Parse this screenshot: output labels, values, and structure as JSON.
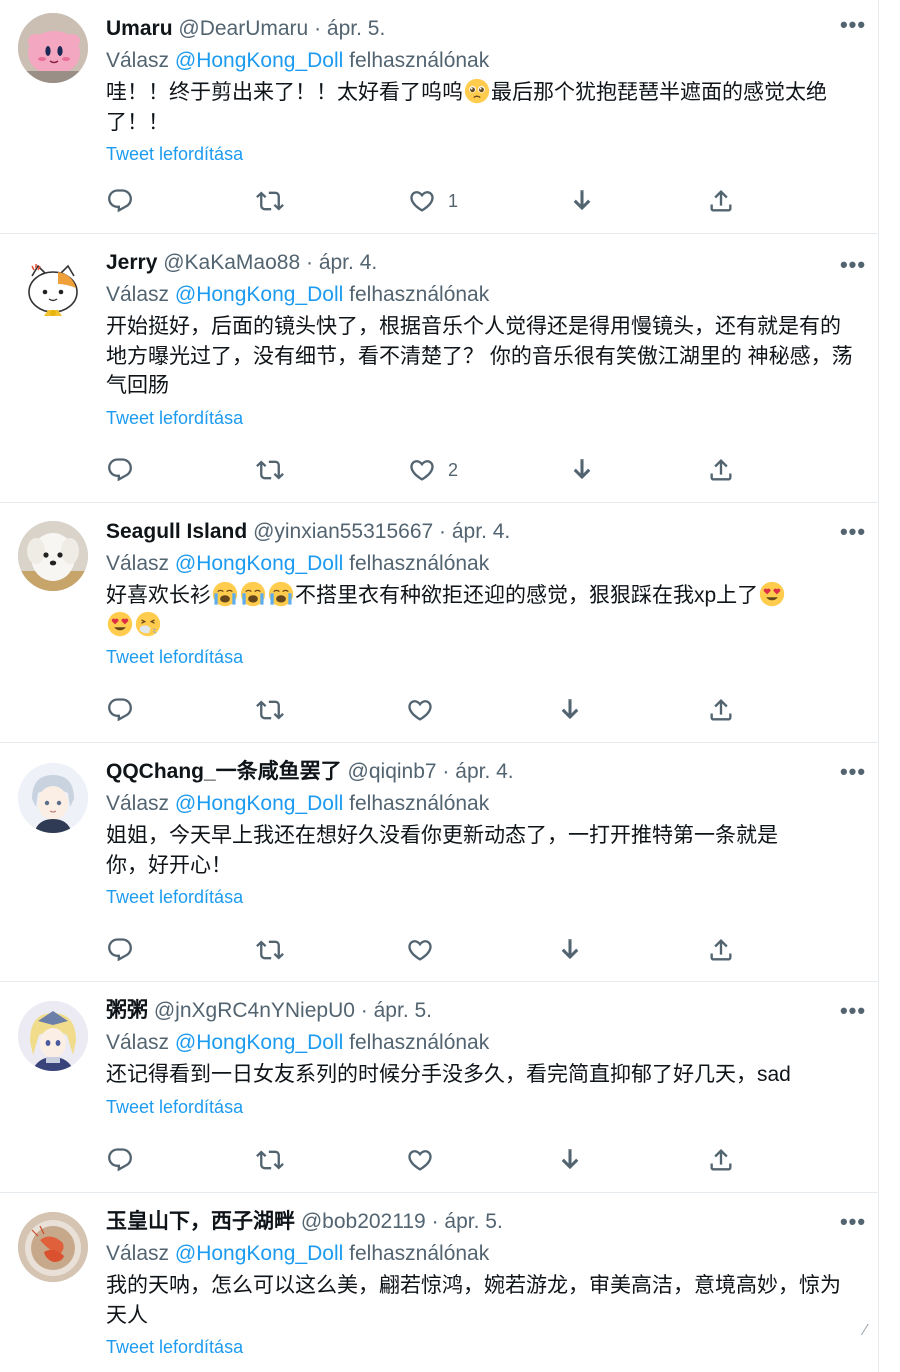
{
  "reply_prefix": "Válasz",
  "reply_suffix": "felhasználónak",
  "translate_label": "Tweet lefordítása",
  "more_label": "•••",
  "colors": {
    "accent": "#1d9bf0",
    "secondary": "#536471",
    "divider": "#e6ecf0"
  },
  "icons": {
    "reply": "reply-icon",
    "retweet": "retweet-icon",
    "like": "heart-icon",
    "download": "download-icon",
    "share": "share-icon"
  },
  "edge_glyph": "⁄",
  "tweets": [
    {
      "name": "Umaru",
      "handle": "@DearUmaru",
      "dot": "·",
      "date": "ápr. 5.",
      "mention": "@HongKong_Doll",
      "text_a": "哇！！终于剪出来了！！太好看了呜呜",
      "emoji_a": "pleading-face",
      "text_b": "最后那个犹抱琵琶半遮面的感觉太绝了！！",
      "likes": "1",
      "avatar": "kirby-plush"
    },
    {
      "name": "Jerry",
      "handle": "@KaKaMao88",
      "dot": "·",
      "date": "ápr. 4.",
      "mention": "@HongKong_Doll",
      "text": "开始挺好，后面的镜头快了，根据音乐个人觉得还是得用慢镜头，还有就是有的地方曝光过了，没有细节，看不清楚了？ 你的音乐很有笑傲江湖里的 神秘感，荡气回肠",
      "likes": "2",
      "avatar": "cartoon-cat"
    },
    {
      "name": "Seagull Island",
      "handle": "@yinxian55315667",
      "dot": "·",
      "date": "ápr. 4.",
      "mention": "@HongKong_Doll",
      "text_a": "好喜欢长衫",
      "emoji_a": "loudly-crying-face",
      "text_b": "不搭里衣有种欲拒还迎的感觉，狠狠踩在我xp上了",
      "emoji_b": "heart-eyes-face",
      "emoji_c": "sneezing-face",
      "likes": "",
      "avatar": "white-dog"
    },
    {
      "name": "QQChang_一条咸鱼罢了",
      "handle": "@qiqinb7",
      "dot": "·",
      "date": "ápr. 4.",
      "mention": "@HongKong_Doll",
      "text": "姐姐，今天早上我还在想好久没看你更新动态了，一打开推特第一条就是你，好开心！",
      "likes": "",
      "avatar": "anime-boy"
    },
    {
      "name": "粥粥",
      "handle": "@jnXgRC4nYNiepU0",
      "dot": "·",
      "date": "ápr. 5.",
      "mention": "@HongKong_Doll",
      "text": "还记得看到一日女友系列的时候分手没多久，看完简直抑郁了好几天，sad",
      "likes": "",
      "avatar": "armored-anime-girl"
    },
    {
      "name": "玉皇山下，西子湖畔",
      "handle": "@bob202119",
      "dot": "·",
      "date": "ápr. 5.",
      "mention": "@HongKong_Doll",
      "text": "我的天呐，怎么可以这么美，翩若惊鸿，婉若游龙，审美高洁，意境高妙，惊为天人",
      "likes": "",
      "avatar": "shrimp-plate"
    }
  ]
}
